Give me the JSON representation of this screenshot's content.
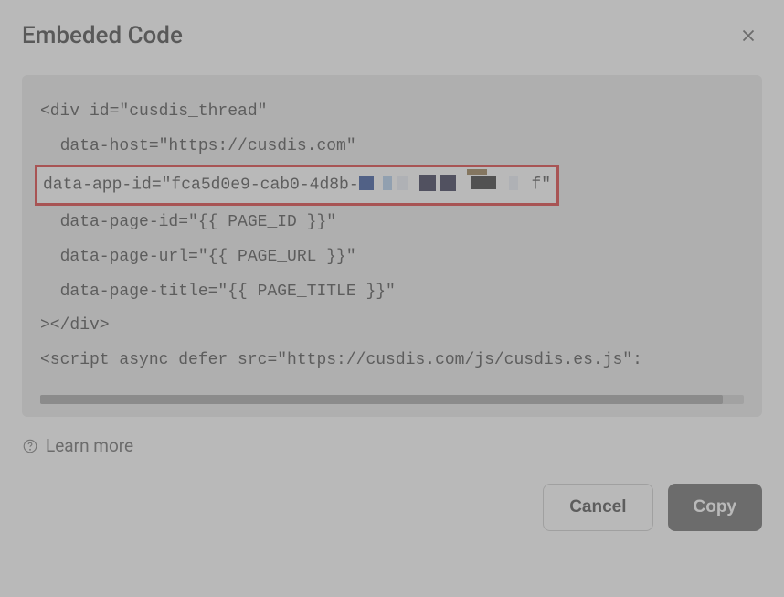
{
  "dialog": {
    "title": "Embeded Code",
    "learn_more_label": "Learn more",
    "cancel_label": "Cancel",
    "copy_label": "Copy"
  },
  "code": {
    "line1": "<div id=\"cusdis_thread\"",
    "line2": "  data-host=\"https://cusdis.com\"",
    "line3_prefix": "  data-app-id=\"fca5d0e9-cab0-4d8b-",
    "line3_suffix": "f\"",
    "line4": "  data-page-id=\"{{ PAGE_ID }}\"",
    "line5": "  data-page-url=\"{{ PAGE_URL }}\"",
    "line6": "  data-page-title=\"{{ PAGE_TITLE }}\"",
    "line7": "></div>",
    "line8": "<script async defer src=\"https://cusdis.com/js/cusdis.es.js\":"
  }
}
